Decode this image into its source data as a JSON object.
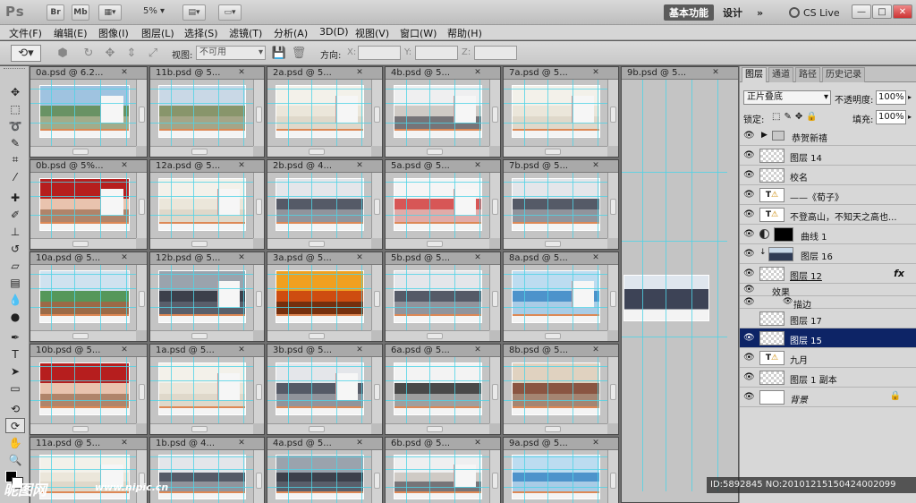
{
  "app": {
    "logo": "Ps"
  },
  "appbar": {
    "bridge": "Br",
    "minibridge": "Mb",
    "zoom": "5%",
    "workspace_active": "基本功能",
    "workspace_design": "设计",
    "more": "»",
    "cslive": "CS Live",
    "win_min": "—",
    "win_restore": "□",
    "win_close": "✕"
  },
  "menu": [
    "文件(F)",
    "编辑(E)",
    "图像(I)",
    "图层(L)",
    "选择(S)",
    "滤镜(T)",
    "分析(A)",
    "3D(D)",
    "视图(V)",
    "窗口(W)",
    "帮助(H)"
  ],
  "options": {
    "view_label": "视图:",
    "view_value": "不可用",
    "direction_label": "方向:",
    "x_label": "X:",
    "y_label": "Y:",
    "z_label": "Z:"
  },
  "documents": [
    {
      "title": "0a.psd @ 6.2...",
      "scene": "campus"
    },
    {
      "title": "11b.psd @ 5...",
      "scene": "field"
    },
    {
      "title": "2a.psd @ 5...",
      "scene": "calendar-art"
    },
    {
      "title": "4b.psd @ 5...",
      "scene": "portrait"
    },
    {
      "title": "7a.psd @ 5...",
      "scene": "calendar-art"
    },
    {
      "title": "9b.psd @ 5...",
      "scene": "empty"
    },
    {
      "title": "0b.psd @ 5%...",
      "scene": "stage"
    },
    {
      "title": "12a.psd @ 5...",
      "scene": "calendar-art"
    },
    {
      "title": "2b.psd @ 4...",
      "scene": "group"
    },
    {
      "title": "5a.psd @ 5...",
      "scene": "ribbon"
    },
    {
      "title": "7b.psd @ 5...",
      "scene": "group"
    },
    {
      "title": "10a.psd @ 5...",
      "scene": "track"
    },
    {
      "title": "12b.psd @ 5...",
      "scene": "crowd"
    },
    {
      "title": "3a.psd @ 5...",
      "scene": "sunset"
    },
    {
      "title": "5b.psd @ 5...",
      "scene": "group"
    },
    {
      "title": "8a.psd @ 5...",
      "scene": "sea"
    },
    {
      "title": "10b.psd @ 5...",
      "scene": "stage"
    },
    {
      "title": "1a.psd @ 5...",
      "scene": "calendar-art"
    },
    {
      "title": "3b.psd @ 5...",
      "scene": "group"
    },
    {
      "title": "6a.psd @ 5...",
      "scene": "disc"
    },
    {
      "title": "8b.psd @ 5...",
      "scene": "meeting"
    },
    {
      "title": "11a.psd @ 5...",
      "scene": "calendar-art"
    },
    {
      "title": "1b.psd @ 4...",
      "scene": "group"
    },
    {
      "title": "4a.psd @ 5...",
      "scene": "crowd"
    },
    {
      "title": "6b.psd @ 5...",
      "scene": "portrait"
    },
    {
      "title": "9a.psd @ 5...",
      "scene": "sea"
    }
  ],
  "layers_panel": {
    "tabs": [
      "图层",
      "通道",
      "路径",
      "历史记录"
    ],
    "blend_mode": "正片叠底",
    "opacity_label": "不透明度:",
    "opacity_value": "100%",
    "lock_label": "锁定:",
    "fill_label": "填充:",
    "fill_value": "100%",
    "layers": [
      {
        "name": "恭贺新禧",
        "kind": "group",
        "visible": true
      },
      {
        "name": "图层 14",
        "kind": "pixel",
        "visible": true
      },
      {
        "name": "校名",
        "kind": "pixel",
        "visible": true
      },
      {
        "name": "——《荀子》",
        "kind": "text",
        "visible": true
      },
      {
        "name": "不登高山，不知天之高也...",
        "kind": "text",
        "visible": true
      },
      {
        "name": "曲线 1",
        "kind": "adjust",
        "visible": true
      },
      {
        "name": "图层 16",
        "kind": "photo",
        "visible": true
      },
      {
        "name": "图层 12",
        "kind": "pixel",
        "visible": true,
        "fx": "fx"
      },
      {
        "name": "效果",
        "kind": "effect",
        "visible": true
      },
      {
        "name": "描边",
        "kind": "effect-item",
        "visible": true
      },
      {
        "name": "图层 17",
        "kind": "pixel",
        "visible": false
      },
      {
        "name": "图层 15",
        "kind": "pixel",
        "visible": true,
        "selected": true
      },
      {
        "name": "九月",
        "kind": "text",
        "visible": true
      },
      {
        "name": "图层 1 副本",
        "kind": "pixel",
        "visible": true
      },
      {
        "name": "背景",
        "kind": "background",
        "visible": true,
        "locked": true
      }
    ]
  },
  "status": {
    "text": "ID:5892845 NO:20101215150424002099"
  },
  "watermark": {
    "main": "昵图网",
    "url": "www.nipic.cn"
  },
  "colors": {
    "selection": "#0d2466",
    "guide": "#4fd3e6"
  }
}
